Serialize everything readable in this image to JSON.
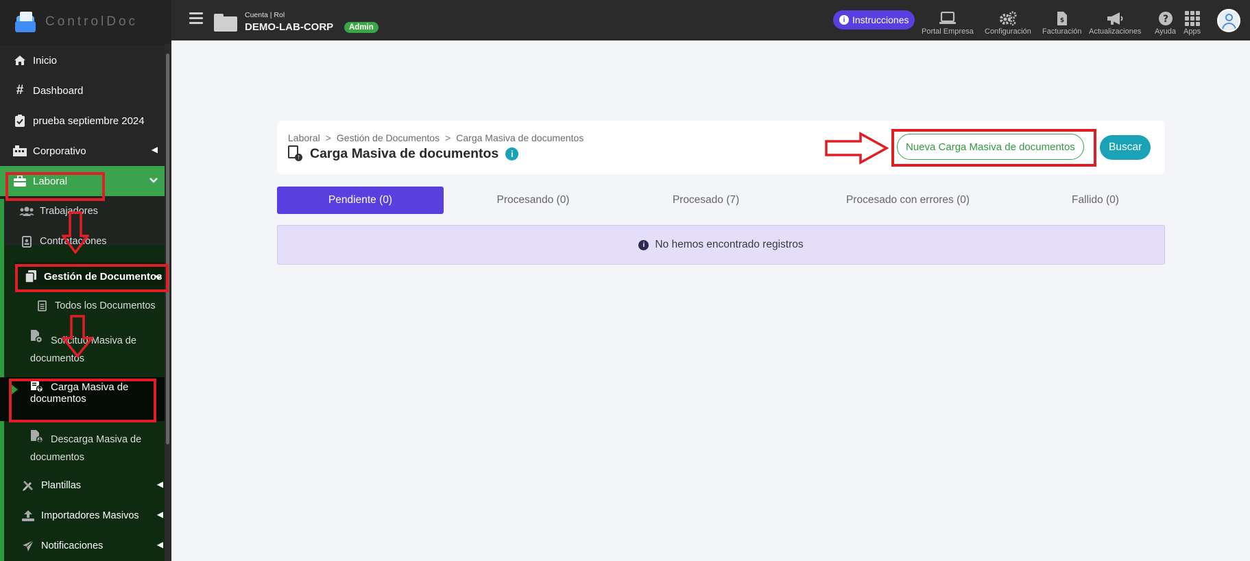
{
  "brand": {
    "name": "ControlDoc"
  },
  "header": {
    "account_label": "Cuenta | Rol",
    "account_name": "DEMO-LAB-CORP",
    "role_badge": "Admin",
    "instructions_label": "Instrucciones",
    "nav": [
      {
        "label": "Portal Empresa",
        "icon": "laptop-icon"
      },
      {
        "label": "Configuración",
        "icon": "gears-icon"
      },
      {
        "label": "Facturación",
        "icon": "invoice-icon"
      },
      {
        "label": "Actualizaciones",
        "icon": "megaphone-icon"
      },
      {
        "label": "Ayuda",
        "icon": "help-icon"
      },
      {
        "label": "Apps",
        "icon": "apps-grid-icon"
      }
    ]
  },
  "sidebar": {
    "items": [
      {
        "label": "Inicio",
        "icon": "home-icon"
      },
      {
        "label": "Dashboard",
        "icon": "hash-icon"
      },
      {
        "label": "prueba septiembre 2024",
        "icon": "clipboard-check-icon"
      },
      {
        "label": "Corporativo",
        "icon": "building-icon"
      },
      {
        "label": "Laboral",
        "icon": "briefcase-icon"
      },
      {
        "label": "Trabajadores",
        "icon": "users-icon"
      },
      {
        "label": "Contrataciones",
        "icon": "id-card-icon"
      },
      {
        "label": "Gestión de Documentos",
        "icon": "copy-icon"
      },
      {
        "label": "Todos los Documentos",
        "icon": "file-lines-icon"
      },
      {
        "label": "Solicitud Masiva de documentos",
        "icon": "file-gear-icon"
      },
      {
        "label": "Carga Masiva de documentos",
        "icon": "file-upload-icon"
      },
      {
        "label": "Descarga Masiva de documentos",
        "icon": "file-download-icon"
      },
      {
        "label": "Plantillas",
        "icon": "pencil-ruler-icon"
      },
      {
        "label": "Importadores Masivos",
        "icon": "upload-icon"
      },
      {
        "label": "Notificaciones",
        "icon": "paper-plane-icon"
      }
    ]
  },
  "page": {
    "breadcrumb": [
      "Laboral",
      "Gestión de Documentos",
      "Carga Masiva de documentos"
    ],
    "breadcrumb_sep": ">",
    "title": "Carga Masiva de documentos",
    "new_button": "Nueva Carga Masiva de documentos",
    "search_button": "Buscar",
    "tabs": [
      {
        "label": "Pendiente (0)",
        "active": true
      },
      {
        "label": "Procesando (0)"
      },
      {
        "label": "Procesado (7)"
      },
      {
        "label": "Procesado con errores (0)"
      },
      {
        "label": "Fallido (0)"
      }
    ],
    "empty_message": "No hemos encontrado registros"
  },
  "colors": {
    "accent_purple": "#5a3fe0",
    "teal": "#1aa3b6",
    "green": "#3ba24d",
    "annotation_red": "#e01e26"
  }
}
